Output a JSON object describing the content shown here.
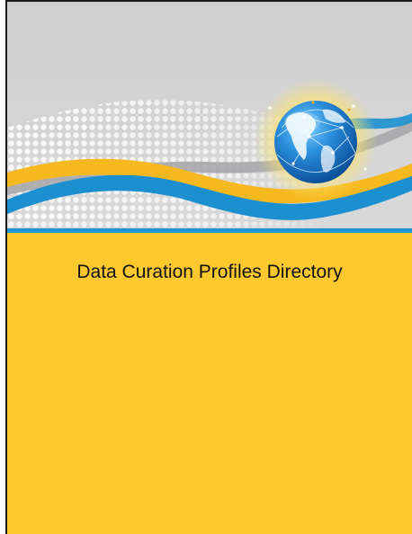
{
  "document": {
    "title": "Data Curation Profiles Directory"
  },
  "colors": {
    "banner_background": "#cfcfd0",
    "divider": "#1e96d3",
    "panel": "#fec92f",
    "wave_yellow": "#f6b81f",
    "wave_blue": "#1c8fd0",
    "wave_gray": "#a9a9ab",
    "globe_blue": "#1a74c4"
  },
  "icons": {
    "cover_art": "globe-with-waves-illustration"
  }
}
